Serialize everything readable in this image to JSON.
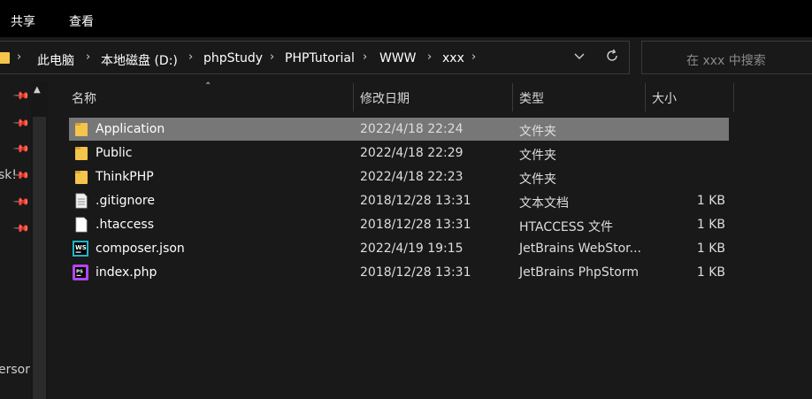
{
  "ribbon": {
    "tabs": [
      "共享",
      "查看"
    ]
  },
  "address": {
    "crumbs": [
      "此电脑",
      "本地磁盘 (D:)",
      "phpStudy",
      "PHPTutorial",
      "WWW",
      "xxx"
    ]
  },
  "search": {
    "placeholder": "在 xxx 中搜索"
  },
  "nav": {
    "partial_labels": [
      "sk!",
      "ersor"
    ]
  },
  "columns": {
    "name": "名称",
    "date": "修改日期",
    "type": "类型",
    "size": "大小"
  },
  "files": [
    {
      "name": "Application",
      "date": "2022/4/18 22:24",
      "type": "文件夹",
      "size": "",
      "icon": "folder-icon",
      "selected": true
    },
    {
      "name": "Public",
      "date": "2022/4/18 22:29",
      "type": "文件夹",
      "size": "",
      "icon": "folder-icon"
    },
    {
      "name": "ThinkPHP",
      "date": "2022/4/18 22:23",
      "type": "文件夹",
      "size": "",
      "icon": "folder-icon"
    },
    {
      "name": ".gitignore",
      "date": "2018/12/28 13:31",
      "type": "文本文档",
      "size": "1 KB",
      "icon": "text-file-icon"
    },
    {
      "name": ".htaccess",
      "date": "2018/12/28 13:31",
      "type": "HTACCESS 文件",
      "size": "1 KB",
      "icon": "file-icon"
    },
    {
      "name": "composer.json",
      "date": "2022/4/19 19:15",
      "type": "JetBrains WebStor...",
      "size": "1 KB",
      "icon": "webstorm-icon"
    },
    {
      "name": "index.php",
      "date": "2018/12/28 13:31",
      "type": "JetBrains PhpStorm",
      "size": "1 KB",
      "icon": "phpstorm-icon"
    }
  ],
  "colors": {
    "background": "#191919",
    "ribbon": "#000000",
    "selection": "#777777",
    "folder": "#f5c44b"
  }
}
